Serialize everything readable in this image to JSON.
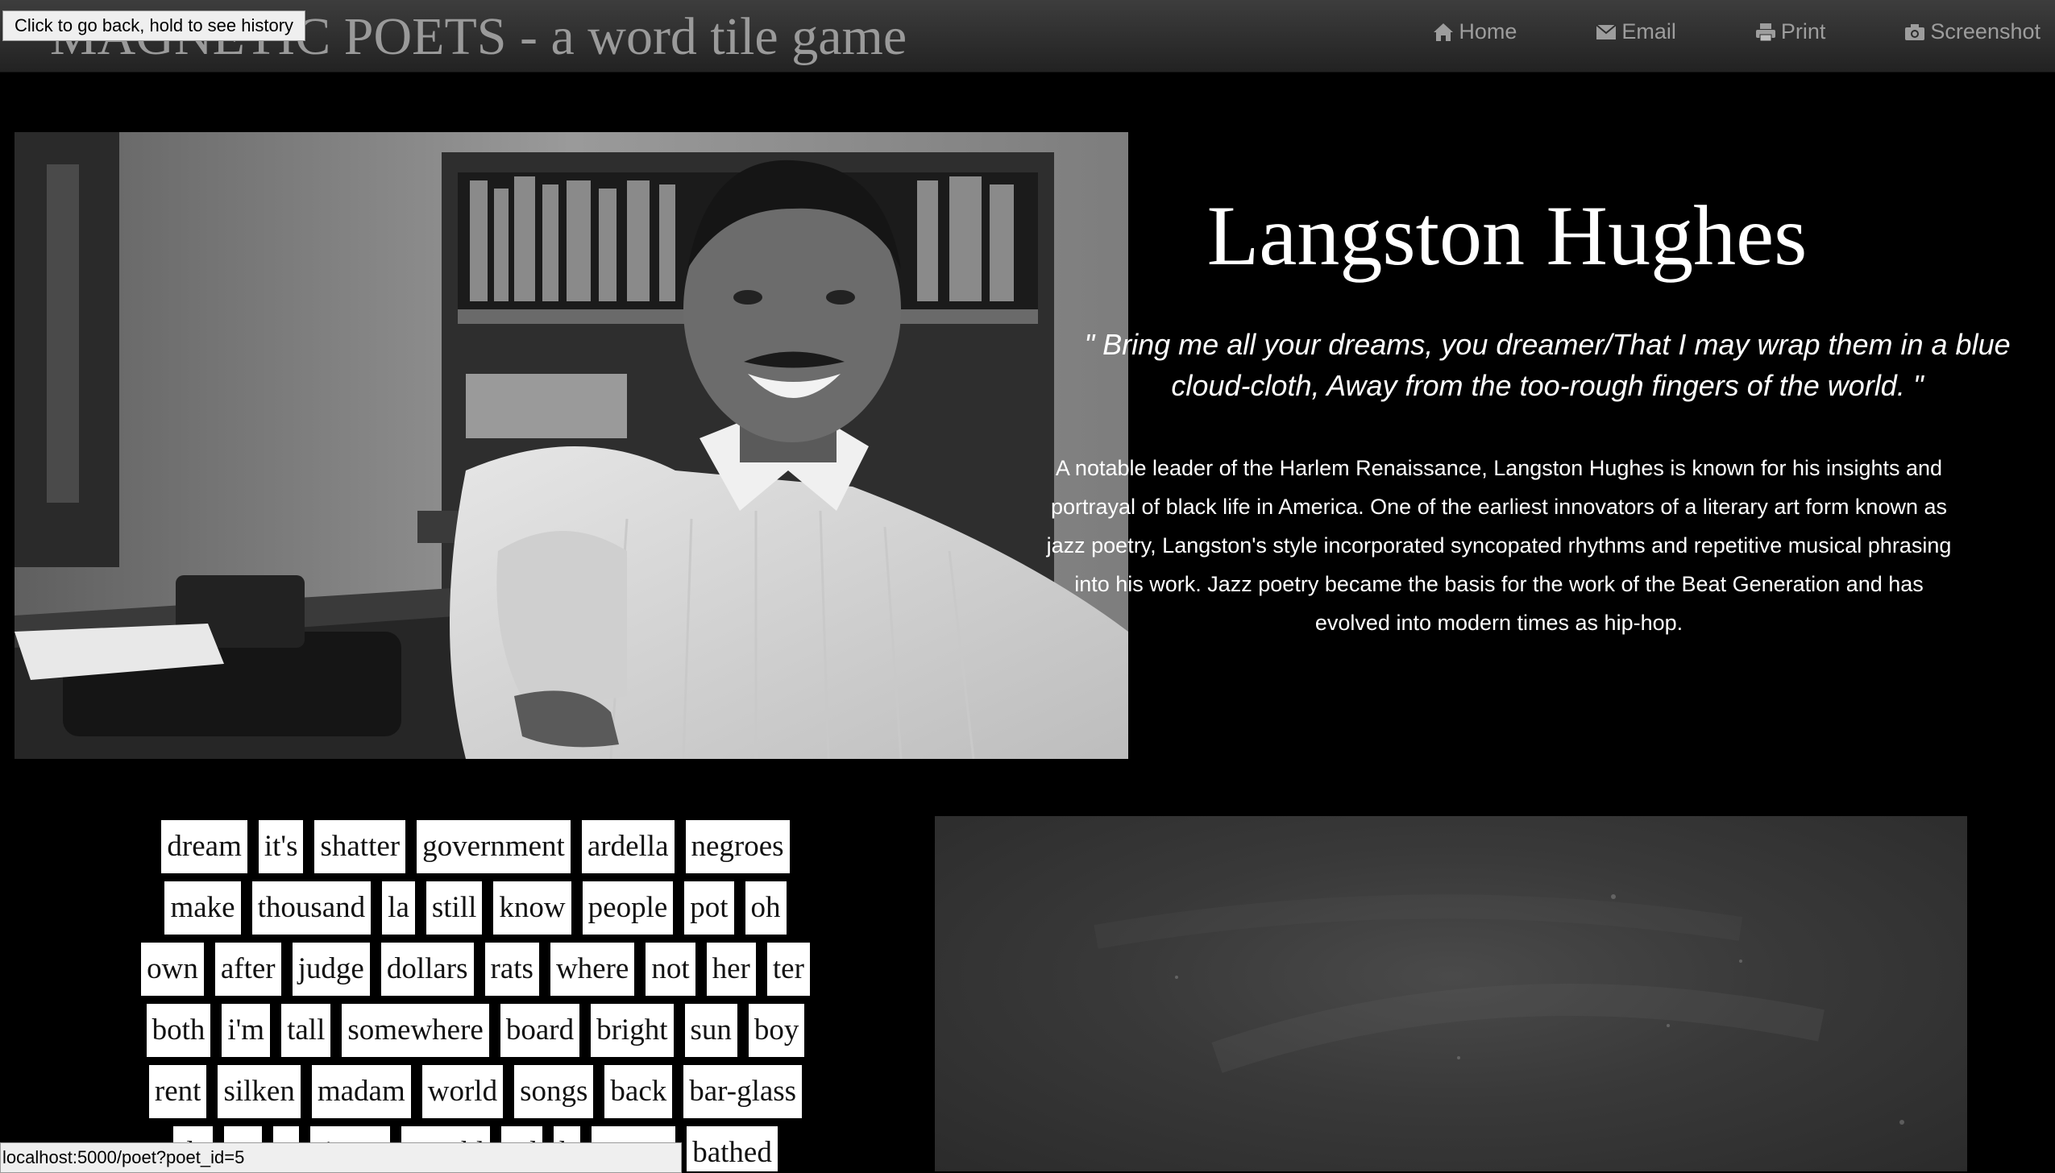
{
  "navbar": {
    "brand": "MAGNETIC POETS - a word tile game",
    "links": [
      {
        "label": "Home",
        "icon": "home-icon"
      },
      {
        "label": "Email",
        "icon": "envelope-icon"
      },
      {
        "label": "Print",
        "icon": "print-icon"
      },
      {
        "label": "Screenshot",
        "icon": "camera-icon"
      }
    ]
  },
  "back_tooltip": "Click to go back, hold to see history",
  "poet": {
    "name": "Langston Hughes",
    "quote": "\" Bring me all your dreams, you dreamer/That I may wrap them in a blue cloud-cloth, Away from the too-rough fingers of the world. \"",
    "bio": "A notable leader of the Harlem Renaissance, Langston Hughes is known for his insights and portrayal of black life in America. One of the earliest innovators of a literary art form known as jazz poetry, Langston's style incorporated syncopated rhythms and repetitive musical phrasing into his work. Jazz poetry became the basis for the work of the Beat Generation and has evolved into modern times as hip-hop."
  },
  "tiles": {
    "rows": [
      [
        "dream",
        "it's",
        "shatter",
        "government",
        "ardella",
        "negroes"
      ],
      [
        "make",
        "thousand",
        "la",
        "still",
        "know",
        "people",
        "pot",
        "oh"
      ],
      [
        "own",
        "after",
        "judge",
        "dollars",
        "rats",
        "where",
        "not",
        "her",
        "ter"
      ],
      [
        "both",
        "i'm",
        "tall",
        "somewhere",
        "board",
        "bright",
        "sun",
        "boy"
      ],
      [
        "rent",
        "silken",
        "madam",
        "world",
        "songs",
        "back",
        "bar-glass"
      ],
      [
        "de",
        "ca",
        "y",
        "tiptoe",
        "trembl",
        "nd",
        "b",
        "cream",
        "bathed"
      ]
    ]
  },
  "status_bar": "localhost:5000/poet?poet_id=5",
  "colors": {
    "background": "#000000",
    "navbar": "#2c2c2c",
    "nav_text": "#9d9d9d",
    "tile_bg": "#ffffff",
    "chalkboard": "#3a3a3a"
  }
}
